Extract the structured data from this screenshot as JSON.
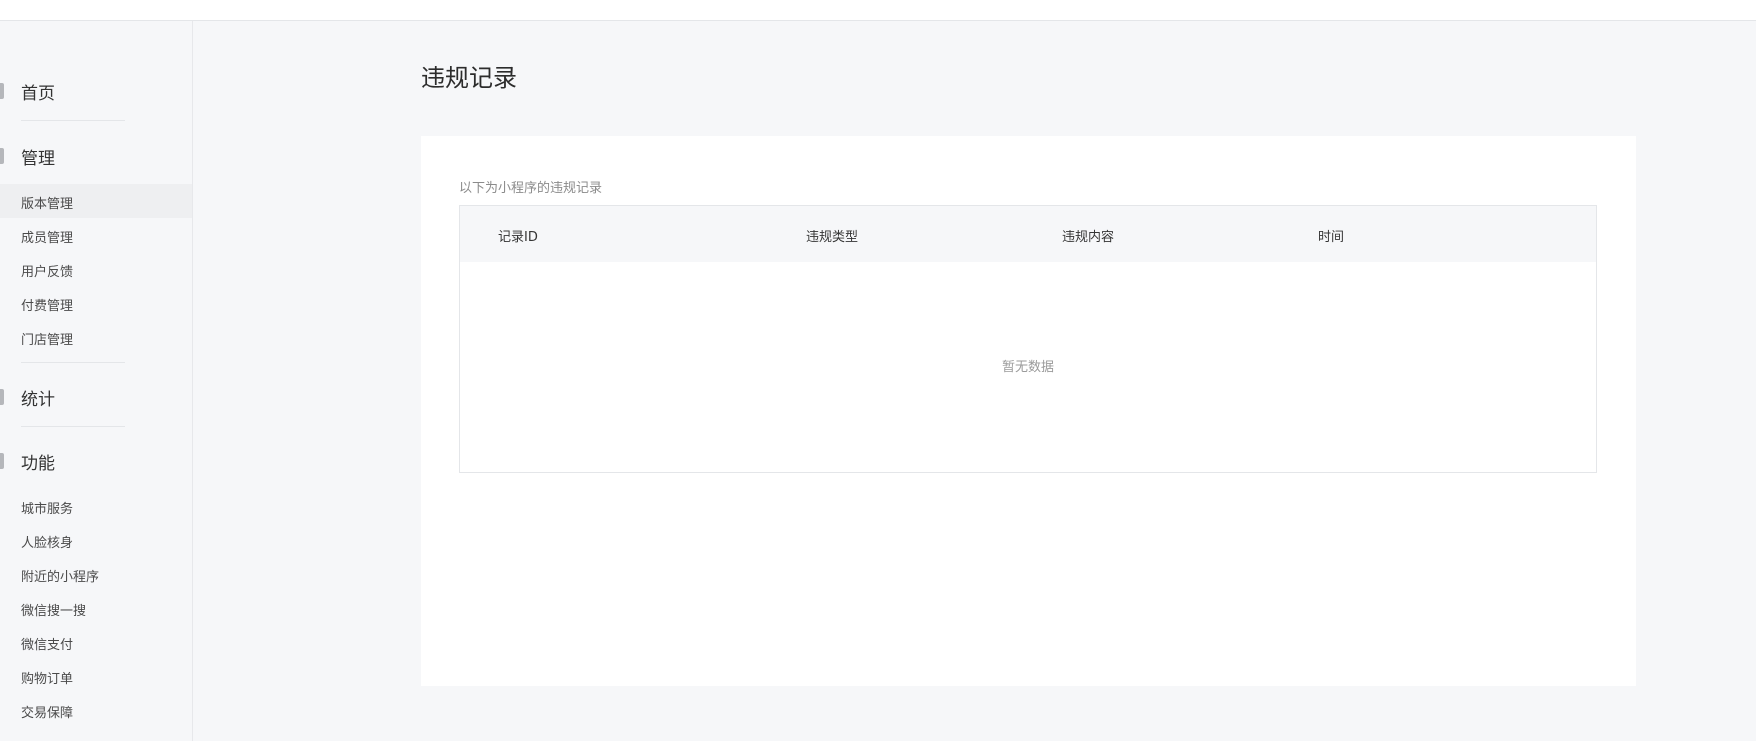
{
  "sidebar": {
    "sections": [
      {
        "label": "首页",
        "icon": "home-icon"
      },
      {
        "label": "管理",
        "icon": "manage-icon"
      },
      {
        "label": "统计",
        "icon": "stats-icon"
      },
      {
        "label": "功能",
        "icon": "features-icon"
      }
    ],
    "manage_items": [
      {
        "label": "版本管理",
        "active": true
      },
      {
        "label": "成员管理"
      },
      {
        "label": "用户反馈"
      },
      {
        "label": "付费管理"
      },
      {
        "label": "门店管理"
      }
    ],
    "feature_items": [
      {
        "label": "城市服务"
      },
      {
        "label": "人脸核身"
      },
      {
        "label": "附近的小程序"
      },
      {
        "label": "微信搜一搜"
      },
      {
        "label": "微信支付"
      },
      {
        "label": "购物订单"
      },
      {
        "label": "交易保障"
      }
    ]
  },
  "main": {
    "title": "违规记录",
    "description": "以下为小程序的违规记录",
    "table": {
      "columns": [
        "记录ID",
        "违规类型",
        "违规内容",
        "时间"
      ],
      "empty_text": "暂无数据"
    }
  }
}
